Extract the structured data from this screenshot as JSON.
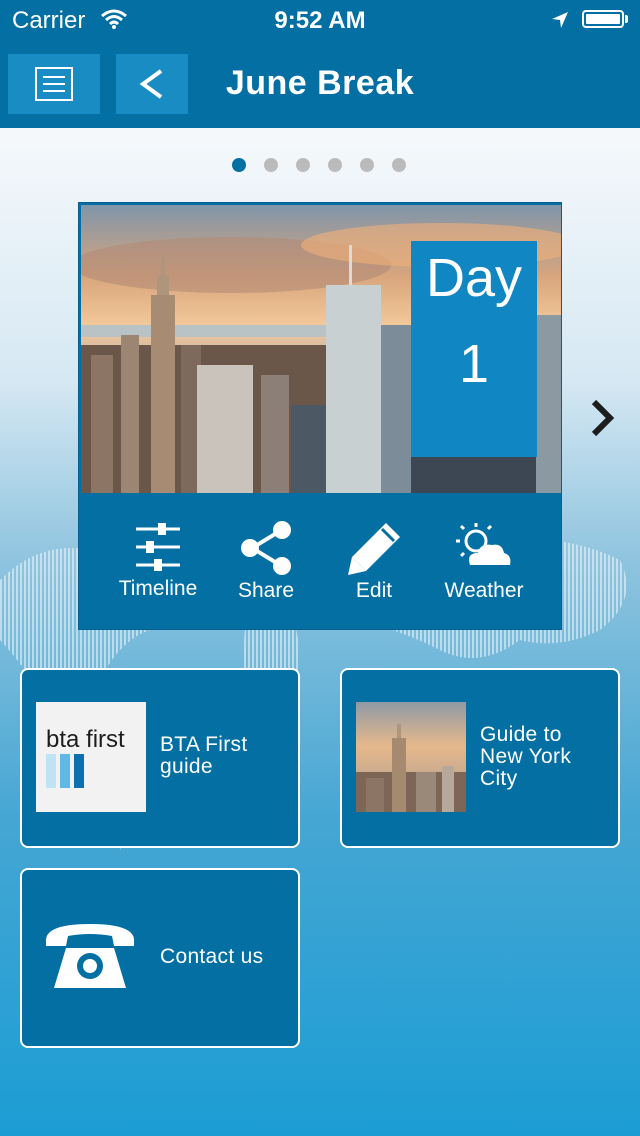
{
  "status_bar": {
    "carrier": "Carrier",
    "time": "9:52 AM"
  },
  "nav": {
    "title": "June Break",
    "back_glyph": "<",
    "menu_icon": "list-icon"
  },
  "carousel": {
    "page_count": 6,
    "current_page": 1
  },
  "day_card": {
    "day_label": "Day",
    "day_number": "1",
    "actions": [
      {
        "label": "Timeline",
        "icon": "sliders-icon"
      },
      {
        "label": "Share",
        "icon": "share-icon"
      },
      {
        "label": "Edit",
        "icon": "pencil-icon"
      },
      {
        "label": "Weather",
        "icon": "sun-cloud-icon"
      }
    ]
  },
  "tiles": [
    {
      "label": "BTA First guide",
      "logo_text": "bta first",
      "icon": "bta-logo"
    },
    {
      "label": "Guide to New York City",
      "icon": "nyc-thumbnail"
    },
    {
      "label": "Contact us",
      "icon": "phone-icon"
    }
  ],
  "colors": {
    "primary": "#036fa3",
    "accent": "#1086c2",
    "active_dot": "#036fa3",
    "inactive_dot": "#bbbbbb"
  }
}
